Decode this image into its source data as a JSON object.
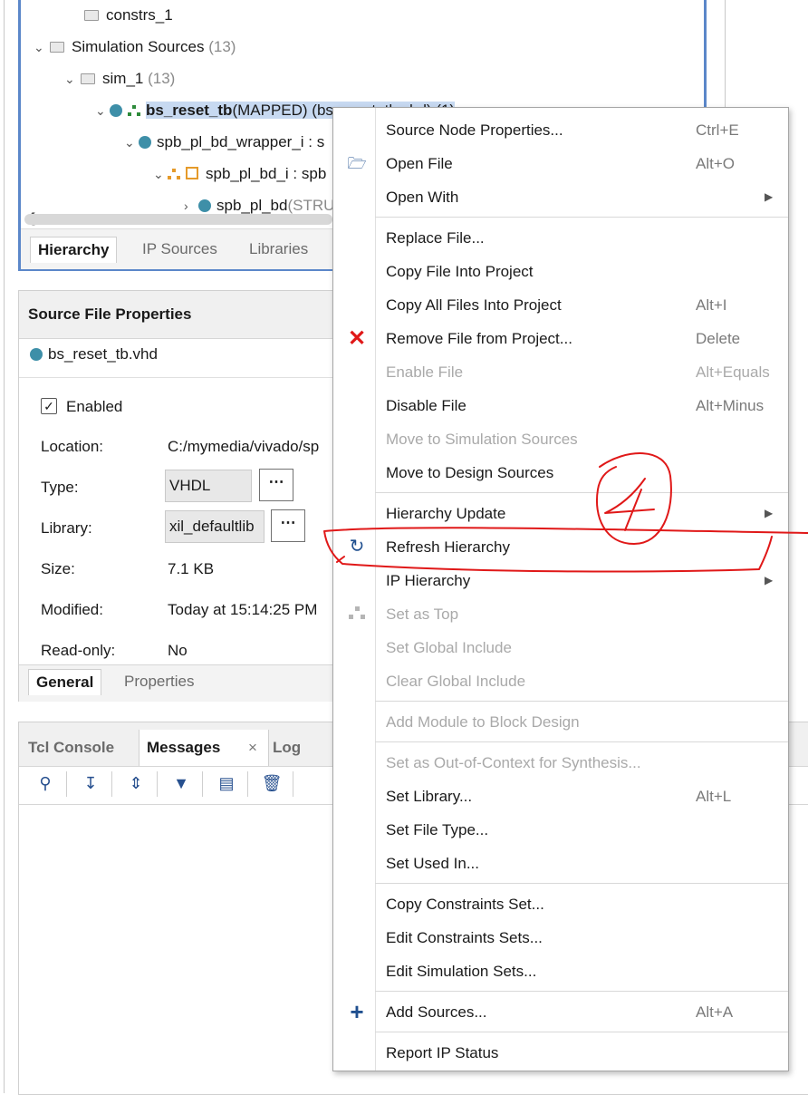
{
  "sources": {
    "tree": [
      {
        "label": "constrs_1",
        "count": ""
      },
      {
        "label": "Simulation Sources",
        "count": "(13)"
      },
      {
        "label": "sim_1",
        "count": "(13)"
      },
      {
        "label_bold": "bs_reset_tb",
        "label_rest": "(MAPPED) (bs_reset_tb.vhd) (1)"
      },
      {
        "label": "spb_pl_bd_wrapper_i : s"
      },
      {
        "label": "spb_pl_bd_i : spb"
      },
      {
        "label": "spb_pl_bd",
        "suffix": "(STRU"
      }
    ],
    "tabs": [
      "Hierarchy",
      "IP Sources",
      "Libraries"
    ]
  },
  "props": {
    "title": "Source File Properties",
    "file": "bs_reset_tb.vhd",
    "enabled_label": "Enabled",
    "dots": "⋯",
    "rows": {
      "location": {
        "label": "Location:",
        "value": "C:/mymedia/vivado/sp"
      },
      "type": {
        "label": "Type:",
        "value": "VHDL"
      },
      "library": {
        "label": "Library:",
        "value": "xil_defaultlib"
      },
      "size": {
        "label": "Size:",
        "value": "7.1 KB"
      },
      "modified": {
        "label": "Modified:",
        "value": "Today at 15:14:25 PM"
      },
      "readonly": {
        "label": "Read-only:",
        "value": "No"
      }
    },
    "tabs": [
      "General",
      "Properties"
    ]
  },
  "console": {
    "tabs": [
      "Tcl Console",
      "Messages",
      "Log"
    ],
    "close": "×"
  },
  "menu": {
    "items": [
      {
        "label": "Source Node Properties...",
        "shortcut": "Ctrl+E"
      },
      {
        "label": "Open File",
        "shortcut": "Alt+O",
        "icon": "folder-open-icon"
      },
      {
        "label": "Open With",
        "submenu": true
      },
      {
        "label": "Replace File..."
      },
      {
        "label": "Copy File Into Project"
      },
      {
        "label": "Copy All Files Into Project",
        "shortcut": "Alt+I"
      },
      {
        "label": "Remove File from Project...",
        "shortcut": "Delete",
        "icon": "remove-x-icon"
      },
      {
        "label": "Enable File",
        "shortcut": "Alt+Equals",
        "disabled": true
      },
      {
        "label": "Disable File",
        "shortcut": "Alt+Minus"
      },
      {
        "label": "Move to Simulation Sources",
        "disabled": true
      },
      {
        "label": "Move to Design Sources"
      },
      {
        "label": "Hierarchy Update",
        "submenu": true
      },
      {
        "label": "Refresh Hierarchy",
        "icon": "refresh-icon"
      },
      {
        "label": "IP Hierarchy",
        "submenu": true
      },
      {
        "label": "Set as Top",
        "disabled": true,
        "icon": "hierarchy-icon"
      },
      {
        "label": "Set Global Include",
        "disabled": true
      },
      {
        "label": "Clear Global Include",
        "disabled": true
      },
      {
        "label": "Add Module to Block Design",
        "disabled": true
      },
      {
        "label": "Set as Out-of-Context for Synthesis...",
        "disabled": true
      },
      {
        "label": "Set Library...",
        "shortcut": "Alt+L"
      },
      {
        "label": "Set File Type..."
      },
      {
        "label": "Set Used In..."
      },
      {
        "label": "Copy Constraints Set..."
      },
      {
        "label": "Edit Constraints Sets..."
      },
      {
        "label": "Edit Simulation Sets..."
      },
      {
        "label": "Add Sources...",
        "shortcut": "Alt+A",
        "icon": "plus-icon"
      },
      {
        "label": "Report IP Status"
      }
    ],
    "arrow": "▶"
  },
  "colors": {
    "accent": "#5b87c9",
    "annotation": "#e01818",
    "selection": "#c7d9f1"
  }
}
